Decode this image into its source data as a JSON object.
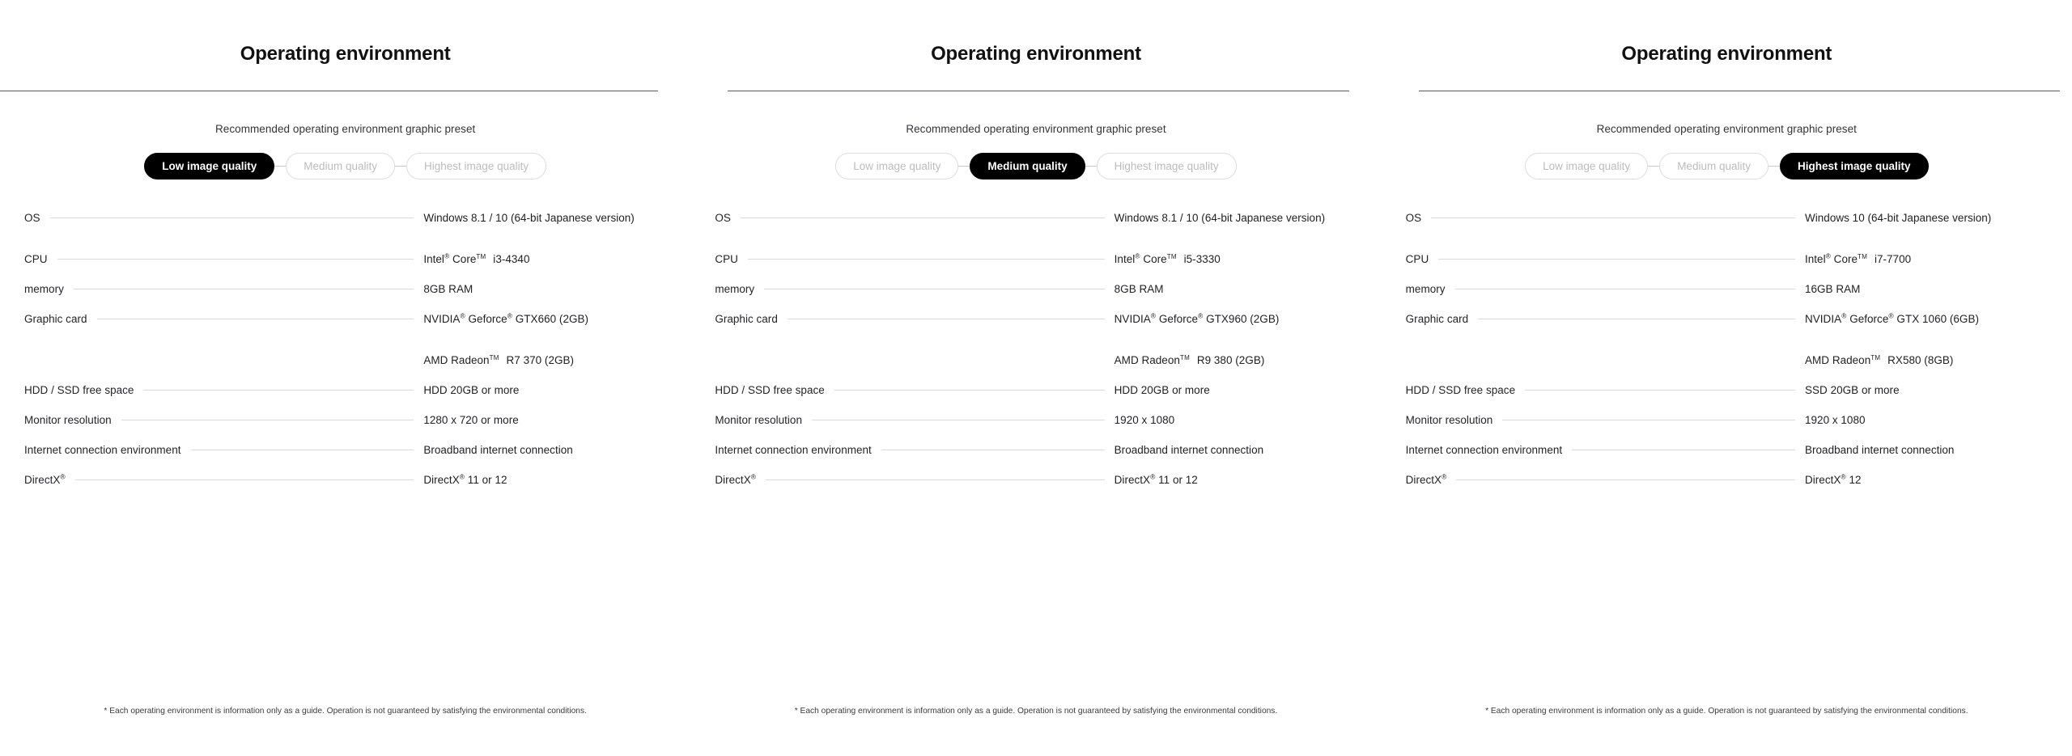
{
  "panels": [
    {
      "title": "Operating environment",
      "preset_caption": "Recommended operating environment graphic preset",
      "presets": [
        {
          "label": "Low image quality",
          "active": true
        },
        {
          "label": "Medium quality",
          "active": false
        },
        {
          "label": "Highest image quality",
          "active": false
        }
      ],
      "specs": [
        {
          "label": "OS",
          "value": "Windows 8.1 / 10 (64-bit Japanese version)"
        },
        {
          "label": "CPU",
          "value": "Intel® Core™ i3-4340"
        },
        {
          "label": "memory",
          "value": "8GB RAM"
        },
        {
          "label": "Graphic card",
          "value": "NVIDIA® Geforce® GTX660 (2GB)"
        },
        {
          "label": "",
          "value": "AMD Radeon™ R7 370 (2GB)"
        },
        {
          "label": "HDD / SSD free space",
          "value": "HDD 20GB or more"
        },
        {
          "label": "Monitor resolution",
          "value": "1280 x 720 or more"
        },
        {
          "label": "Internet connection environment",
          "value": "Broadband internet connection"
        },
        {
          "label": "DirectX®",
          "value": "DirectX® 11 or 12"
        }
      ],
      "footnote": "* Each operating environment is information only as a guide. Operation is not guaranteed by satisfying the environmental conditions."
    },
    {
      "title": "Operating environment",
      "preset_caption": "Recommended operating environment graphic preset",
      "presets": [
        {
          "label": "Low image quality",
          "active": false
        },
        {
          "label": "Medium quality",
          "active": true
        },
        {
          "label": "Highest image quality",
          "active": false
        }
      ],
      "specs": [
        {
          "label": "OS",
          "value": "Windows 8.1 / 10 (64-bit Japanese version)"
        },
        {
          "label": "CPU",
          "value": "Intel® Core™ i5-3330"
        },
        {
          "label": "memory",
          "value": "8GB RAM"
        },
        {
          "label": "Graphic card",
          "value": "NVIDIA® Geforce® GTX960 (2GB)"
        },
        {
          "label": "",
          "value": "AMD Radeon™ R9 380 (2GB)"
        },
        {
          "label": "HDD / SSD free space",
          "value": "HDD 20GB or more"
        },
        {
          "label": "Monitor resolution",
          "value": "1920 x 1080"
        },
        {
          "label": "Internet connection environment",
          "value": "Broadband internet connection"
        },
        {
          "label": "DirectX®",
          "value": "DirectX® 11 or 12"
        }
      ],
      "footnote": "* Each operating environment is information only as a guide. Operation is not guaranteed by satisfying the environmental conditions."
    },
    {
      "title": "Operating environment",
      "preset_caption": "Recommended operating environment graphic preset",
      "presets": [
        {
          "label": "Low image quality",
          "active": false
        },
        {
          "label": "Medium quality",
          "active": false
        },
        {
          "label": "Highest image quality",
          "active": true
        }
      ],
      "specs": [
        {
          "label": "OS",
          "value": "Windows 10 (64-bit Japanese version)"
        },
        {
          "label": "CPU",
          "value": "Intel® Core™ i7-7700"
        },
        {
          "label": "memory",
          "value": "16GB RAM"
        },
        {
          "label": "Graphic card",
          "value": "NVIDIA® Geforce® GTX 1060 (6GB)"
        },
        {
          "label": "",
          "value": "AMD Radeon™ RX580 (8GB)"
        },
        {
          "label": "HDD / SSD free space",
          "value": "SSD 20GB or more"
        },
        {
          "label": "Monitor resolution",
          "value": "1920 x 1080"
        },
        {
          "label": "Internet connection environment",
          "value": "Broadband internet connection"
        },
        {
          "label": "DirectX®",
          "value": "DirectX® 12"
        }
      ],
      "footnote": "* Each operating environment is information only as a guide. Operation is not guaranteed by satisfying the environmental conditions."
    }
  ],
  "colors": {
    "active_pill_bg": "#000000",
    "active_pill_text": "#ffffff",
    "inactive_pill_border": "#dcdcdc",
    "inactive_pill_text": "#bcbcbc",
    "rule": "#5a5a5c",
    "leader": "#dadada",
    "text": "#1a1a1a"
  }
}
